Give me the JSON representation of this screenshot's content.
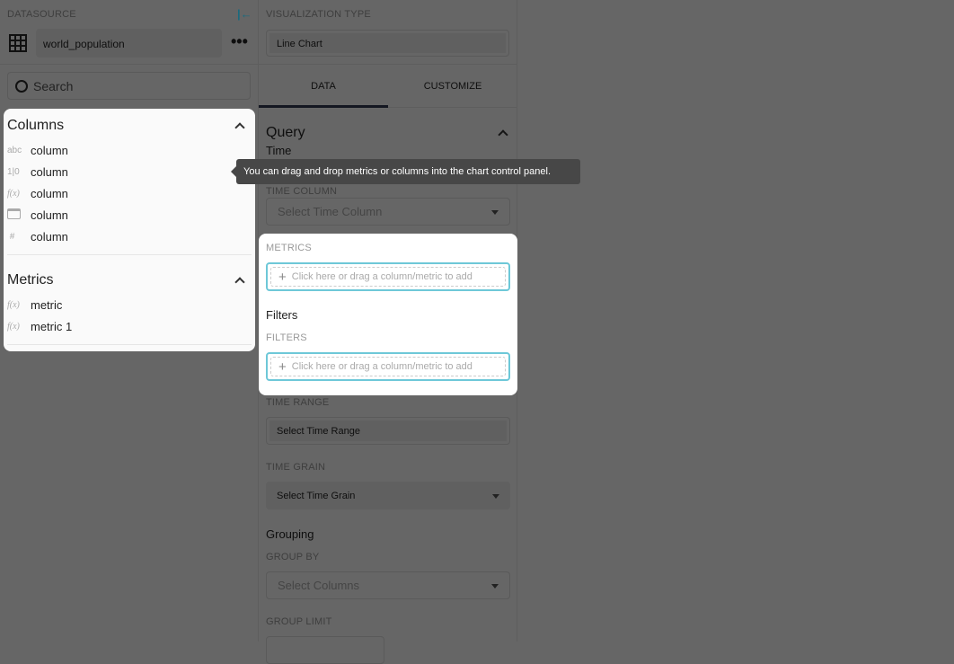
{
  "datasource": {
    "label": "DATASOURCE",
    "name": "world_population",
    "search_placeholder": "Search"
  },
  "columns": {
    "title": "Columns",
    "items": [
      {
        "type": "abc",
        "name": "column"
      },
      {
        "type": "1|0",
        "name": "column"
      },
      {
        "type": "f(x)",
        "name": "column"
      },
      {
        "type": "calendar",
        "name": "column"
      },
      {
        "type": "#",
        "name": "column"
      }
    ]
  },
  "metrics": {
    "title": "Metrics",
    "items": [
      {
        "type": "f(x)",
        "name": "metric"
      },
      {
        "type": "f(x)",
        "name": "metric 1"
      }
    ]
  },
  "viz": {
    "label": "VISUALIZATION TYPE",
    "value": "Line Chart"
  },
  "tabs": [
    {
      "label": "DATA",
      "active": true
    },
    {
      "label": "CUSTOMIZE",
      "active": false
    }
  ],
  "query": {
    "title": "Query",
    "time_section": "Time",
    "time_column_label": "TIME COLUMN",
    "time_column_placeholder": "Select Time Column",
    "metrics_label": "METRICS",
    "drop_placeholder": "Click here or drag a column/metric to add",
    "filters_title": "Filters",
    "filters_label": "FILTERS",
    "time_range_label": "TIME RANGE",
    "time_range_value": "Select Time Range",
    "time_grain_label": "TIME GRAIN",
    "time_grain_value": "Select Time Grain",
    "grouping_title": "Grouping",
    "group_by_label": "GROUP BY",
    "group_by_placeholder": "Select Columns",
    "group_limit_label": "GROUP LIMIT"
  },
  "tooltip": "You can drag and drop metrics or columns into the chart control panel.",
  "colors": {
    "accent": "#20a7c9",
    "drop_border": "#6ec8d8",
    "tab_underline": "#323a52"
  }
}
